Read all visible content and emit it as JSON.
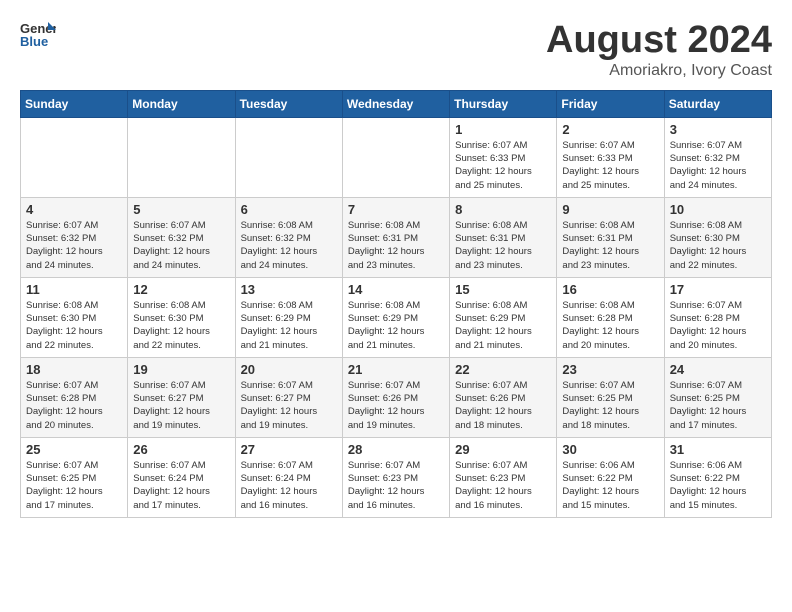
{
  "header": {
    "logo_line1": "General",
    "logo_line2": "Blue",
    "title": "August 2024",
    "subtitle": "Amoriakro, Ivory Coast"
  },
  "days_of_week": [
    "Sunday",
    "Monday",
    "Tuesday",
    "Wednesday",
    "Thursday",
    "Friday",
    "Saturday"
  ],
  "weeks": [
    [
      {
        "day": "",
        "info": ""
      },
      {
        "day": "",
        "info": ""
      },
      {
        "day": "",
        "info": ""
      },
      {
        "day": "",
        "info": ""
      },
      {
        "day": "1",
        "info": "Sunrise: 6:07 AM\nSunset: 6:33 PM\nDaylight: 12 hours\nand 25 minutes."
      },
      {
        "day": "2",
        "info": "Sunrise: 6:07 AM\nSunset: 6:33 PM\nDaylight: 12 hours\nand 25 minutes."
      },
      {
        "day": "3",
        "info": "Sunrise: 6:07 AM\nSunset: 6:32 PM\nDaylight: 12 hours\nand 24 minutes."
      }
    ],
    [
      {
        "day": "4",
        "info": "Sunrise: 6:07 AM\nSunset: 6:32 PM\nDaylight: 12 hours\nand 24 minutes."
      },
      {
        "day": "5",
        "info": "Sunrise: 6:07 AM\nSunset: 6:32 PM\nDaylight: 12 hours\nand 24 minutes."
      },
      {
        "day": "6",
        "info": "Sunrise: 6:08 AM\nSunset: 6:32 PM\nDaylight: 12 hours\nand 24 minutes."
      },
      {
        "day": "7",
        "info": "Sunrise: 6:08 AM\nSunset: 6:31 PM\nDaylight: 12 hours\nand 23 minutes."
      },
      {
        "day": "8",
        "info": "Sunrise: 6:08 AM\nSunset: 6:31 PM\nDaylight: 12 hours\nand 23 minutes."
      },
      {
        "day": "9",
        "info": "Sunrise: 6:08 AM\nSunset: 6:31 PM\nDaylight: 12 hours\nand 23 minutes."
      },
      {
        "day": "10",
        "info": "Sunrise: 6:08 AM\nSunset: 6:30 PM\nDaylight: 12 hours\nand 22 minutes."
      }
    ],
    [
      {
        "day": "11",
        "info": "Sunrise: 6:08 AM\nSunset: 6:30 PM\nDaylight: 12 hours\nand 22 minutes."
      },
      {
        "day": "12",
        "info": "Sunrise: 6:08 AM\nSunset: 6:30 PM\nDaylight: 12 hours\nand 22 minutes."
      },
      {
        "day": "13",
        "info": "Sunrise: 6:08 AM\nSunset: 6:29 PM\nDaylight: 12 hours\nand 21 minutes."
      },
      {
        "day": "14",
        "info": "Sunrise: 6:08 AM\nSunset: 6:29 PM\nDaylight: 12 hours\nand 21 minutes."
      },
      {
        "day": "15",
        "info": "Sunrise: 6:08 AM\nSunset: 6:29 PM\nDaylight: 12 hours\nand 21 minutes."
      },
      {
        "day": "16",
        "info": "Sunrise: 6:08 AM\nSunset: 6:28 PM\nDaylight: 12 hours\nand 20 minutes."
      },
      {
        "day": "17",
        "info": "Sunrise: 6:07 AM\nSunset: 6:28 PM\nDaylight: 12 hours\nand 20 minutes."
      }
    ],
    [
      {
        "day": "18",
        "info": "Sunrise: 6:07 AM\nSunset: 6:28 PM\nDaylight: 12 hours\nand 20 minutes."
      },
      {
        "day": "19",
        "info": "Sunrise: 6:07 AM\nSunset: 6:27 PM\nDaylight: 12 hours\nand 19 minutes."
      },
      {
        "day": "20",
        "info": "Sunrise: 6:07 AM\nSunset: 6:27 PM\nDaylight: 12 hours\nand 19 minutes."
      },
      {
        "day": "21",
        "info": "Sunrise: 6:07 AM\nSunset: 6:26 PM\nDaylight: 12 hours\nand 19 minutes."
      },
      {
        "day": "22",
        "info": "Sunrise: 6:07 AM\nSunset: 6:26 PM\nDaylight: 12 hours\nand 18 minutes."
      },
      {
        "day": "23",
        "info": "Sunrise: 6:07 AM\nSunset: 6:25 PM\nDaylight: 12 hours\nand 18 minutes."
      },
      {
        "day": "24",
        "info": "Sunrise: 6:07 AM\nSunset: 6:25 PM\nDaylight: 12 hours\nand 17 minutes."
      }
    ],
    [
      {
        "day": "25",
        "info": "Sunrise: 6:07 AM\nSunset: 6:25 PM\nDaylight: 12 hours\nand 17 minutes."
      },
      {
        "day": "26",
        "info": "Sunrise: 6:07 AM\nSunset: 6:24 PM\nDaylight: 12 hours\nand 17 minutes."
      },
      {
        "day": "27",
        "info": "Sunrise: 6:07 AM\nSunset: 6:24 PM\nDaylight: 12 hours\nand 16 minutes."
      },
      {
        "day": "28",
        "info": "Sunrise: 6:07 AM\nSunset: 6:23 PM\nDaylight: 12 hours\nand 16 minutes."
      },
      {
        "day": "29",
        "info": "Sunrise: 6:07 AM\nSunset: 6:23 PM\nDaylight: 12 hours\nand 16 minutes."
      },
      {
        "day": "30",
        "info": "Sunrise: 6:06 AM\nSunset: 6:22 PM\nDaylight: 12 hours\nand 15 minutes."
      },
      {
        "day": "31",
        "info": "Sunrise: 6:06 AM\nSunset: 6:22 PM\nDaylight: 12 hours\nand 15 minutes."
      }
    ]
  ]
}
